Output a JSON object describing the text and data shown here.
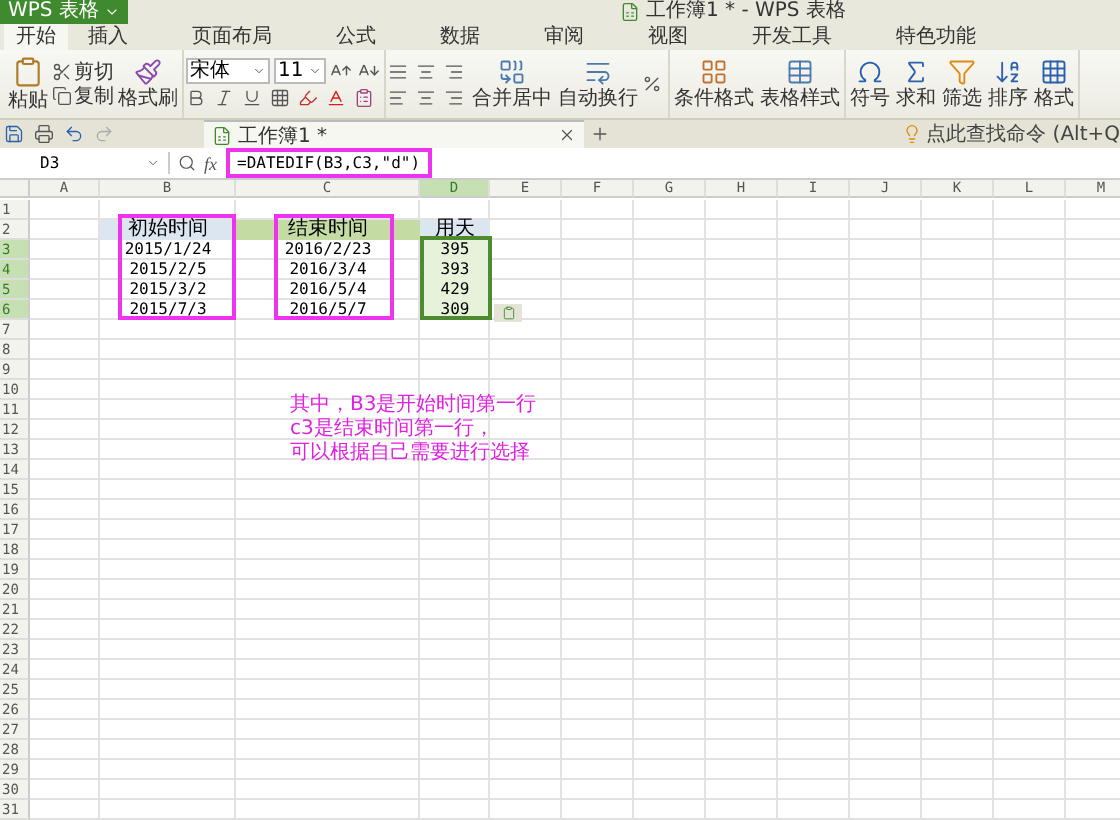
{
  "app_button": "WPS 表格",
  "window": {
    "title": "工作簿1 * - WPS 表格"
  },
  "menu_tabs": [
    {
      "label": "开始",
      "selected": true
    },
    {
      "label": "插入",
      "selected": false
    },
    {
      "label": "页面布局",
      "selected": false
    },
    {
      "label": "公式",
      "selected": false
    },
    {
      "label": "数据",
      "selected": false
    },
    {
      "label": "审阅",
      "selected": false
    },
    {
      "label": "视图",
      "selected": false
    },
    {
      "label": "开发工具",
      "selected": false
    },
    {
      "label": "特色功能",
      "selected": false
    }
  ],
  "ribbon": {
    "paste": "粘贴",
    "cut": "剪切",
    "copy": "复制",
    "format_painter": "格式刷",
    "font_name": "宋体",
    "font_size": "11",
    "merge": "合并居中",
    "wrap": "自动换行",
    "conditional_format": "条件格式",
    "table_style": "表格样式",
    "symbol": "符号",
    "sum": "求和",
    "filter": "筛选",
    "sort": "排序",
    "format": "格式"
  },
  "doc_tabs": [
    {
      "label": "工作簿1 *",
      "selected": true
    }
  ],
  "command_search": "点此查找命令 (Alt+Q",
  "formula_bar": {
    "cell": "D3",
    "fx": "fx",
    "formula": "=DATEDIF(B3,C3,\"d\")"
  },
  "sheet": {
    "columns": [
      {
        "label": "A",
        "selected": false
      },
      {
        "label": "B",
        "selected": false
      },
      {
        "label": "C",
        "selected": false
      },
      {
        "label": "D",
        "selected": true
      },
      {
        "label": "E",
        "selected": false
      },
      {
        "label": "F",
        "selected": false
      },
      {
        "label": "G",
        "selected": false
      },
      {
        "label": "H",
        "selected": false
      },
      {
        "label": "I",
        "selected": false
      },
      {
        "label": "J",
        "selected": false
      },
      {
        "label": "K",
        "selected": false
      },
      {
        "label": "L",
        "selected": false
      },
      {
        "label": "M",
        "selected": false
      }
    ],
    "row_numbers": [
      {
        "label": "1",
        "selected": false
      },
      {
        "label": "2",
        "selected": false
      },
      {
        "label": "3",
        "selected": true
      },
      {
        "label": "4",
        "selected": true
      },
      {
        "label": "5",
        "selected": true
      },
      {
        "label": "6",
        "selected": true
      },
      {
        "label": "7",
        "selected": false
      },
      {
        "label": "8",
        "selected": false
      },
      {
        "label": "9",
        "selected": false
      },
      {
        "label": "10",
        "selected": false
      },
      {
        "label": "11",
        "selected": false
      },
      {
        "label": "12",
        "selected": false
      },
      {
        "label": "13",
        "selected": false
      },
      {
        "label": "14",
        "selected": false
      },
      {
        "label": "15",
        "selected": false
      },
      {
        "label": "16",
        "selected": false
      },
      {
        "label": "17",
        "selected": false
      },
      {
        "label": "18",
        "selected": false
      },
      {
        "label": "19",
        "selected": false
      },
      {
        "label": "20",
        "selected": false
      },
      {
        "label": "21",
        "selected": false
      },
      {
        "label": "22",
        "selected": false
      },
      {
        "label": "23",
        "selected": false
      },
      {
        "label": "24",
        "selected": false
      },
      {
        "label": "25",
        "selected": false
      },
      {
        "label": "26",
        "selected": false
      },
      {
        "label": "27",
        "selected": false
      },
      {
        "label": "28",
        "selected": false
      },
      {
        "label": "29",
        "selected": false
      },
      {
        "label": "30",
        "selected": false
      },
      {
        "label": "31",
        "selected": false
      }
    ],
    "headers": [
      {
        "text": "初始时间",
        "color": "#dce6f1"
      },
      {
        "text": "结束时间",
        "color": "#c4dca4"
      },
      {
        "text": "用天",
        "color": "#dce6f1"
      }
    ],
    "rows": [
      {
        "start": "2015/1/24",
        "end": "2016/2/23",
        "days": "395",
        "selected": true
      },
      {
        "start": "2015/2/5",
        "end": "2016/3/4",
        "days": "393",
        "selected": true
      },
      {
        "start": "2015/3/2",
        "end": "2016/5/4",
        "days": "429",
        "selected": true
      },
      {
        "start": "2015/7/3",
        "end": "2016/5/7",
        "days": "309",
        "selected": true
      }
    ],
    "note": [
      "其中，B3是开始时间第一行",
      "c3是结束时间第一行，",
      "可以根据自己需要进行选择"
    ]
  }
}
